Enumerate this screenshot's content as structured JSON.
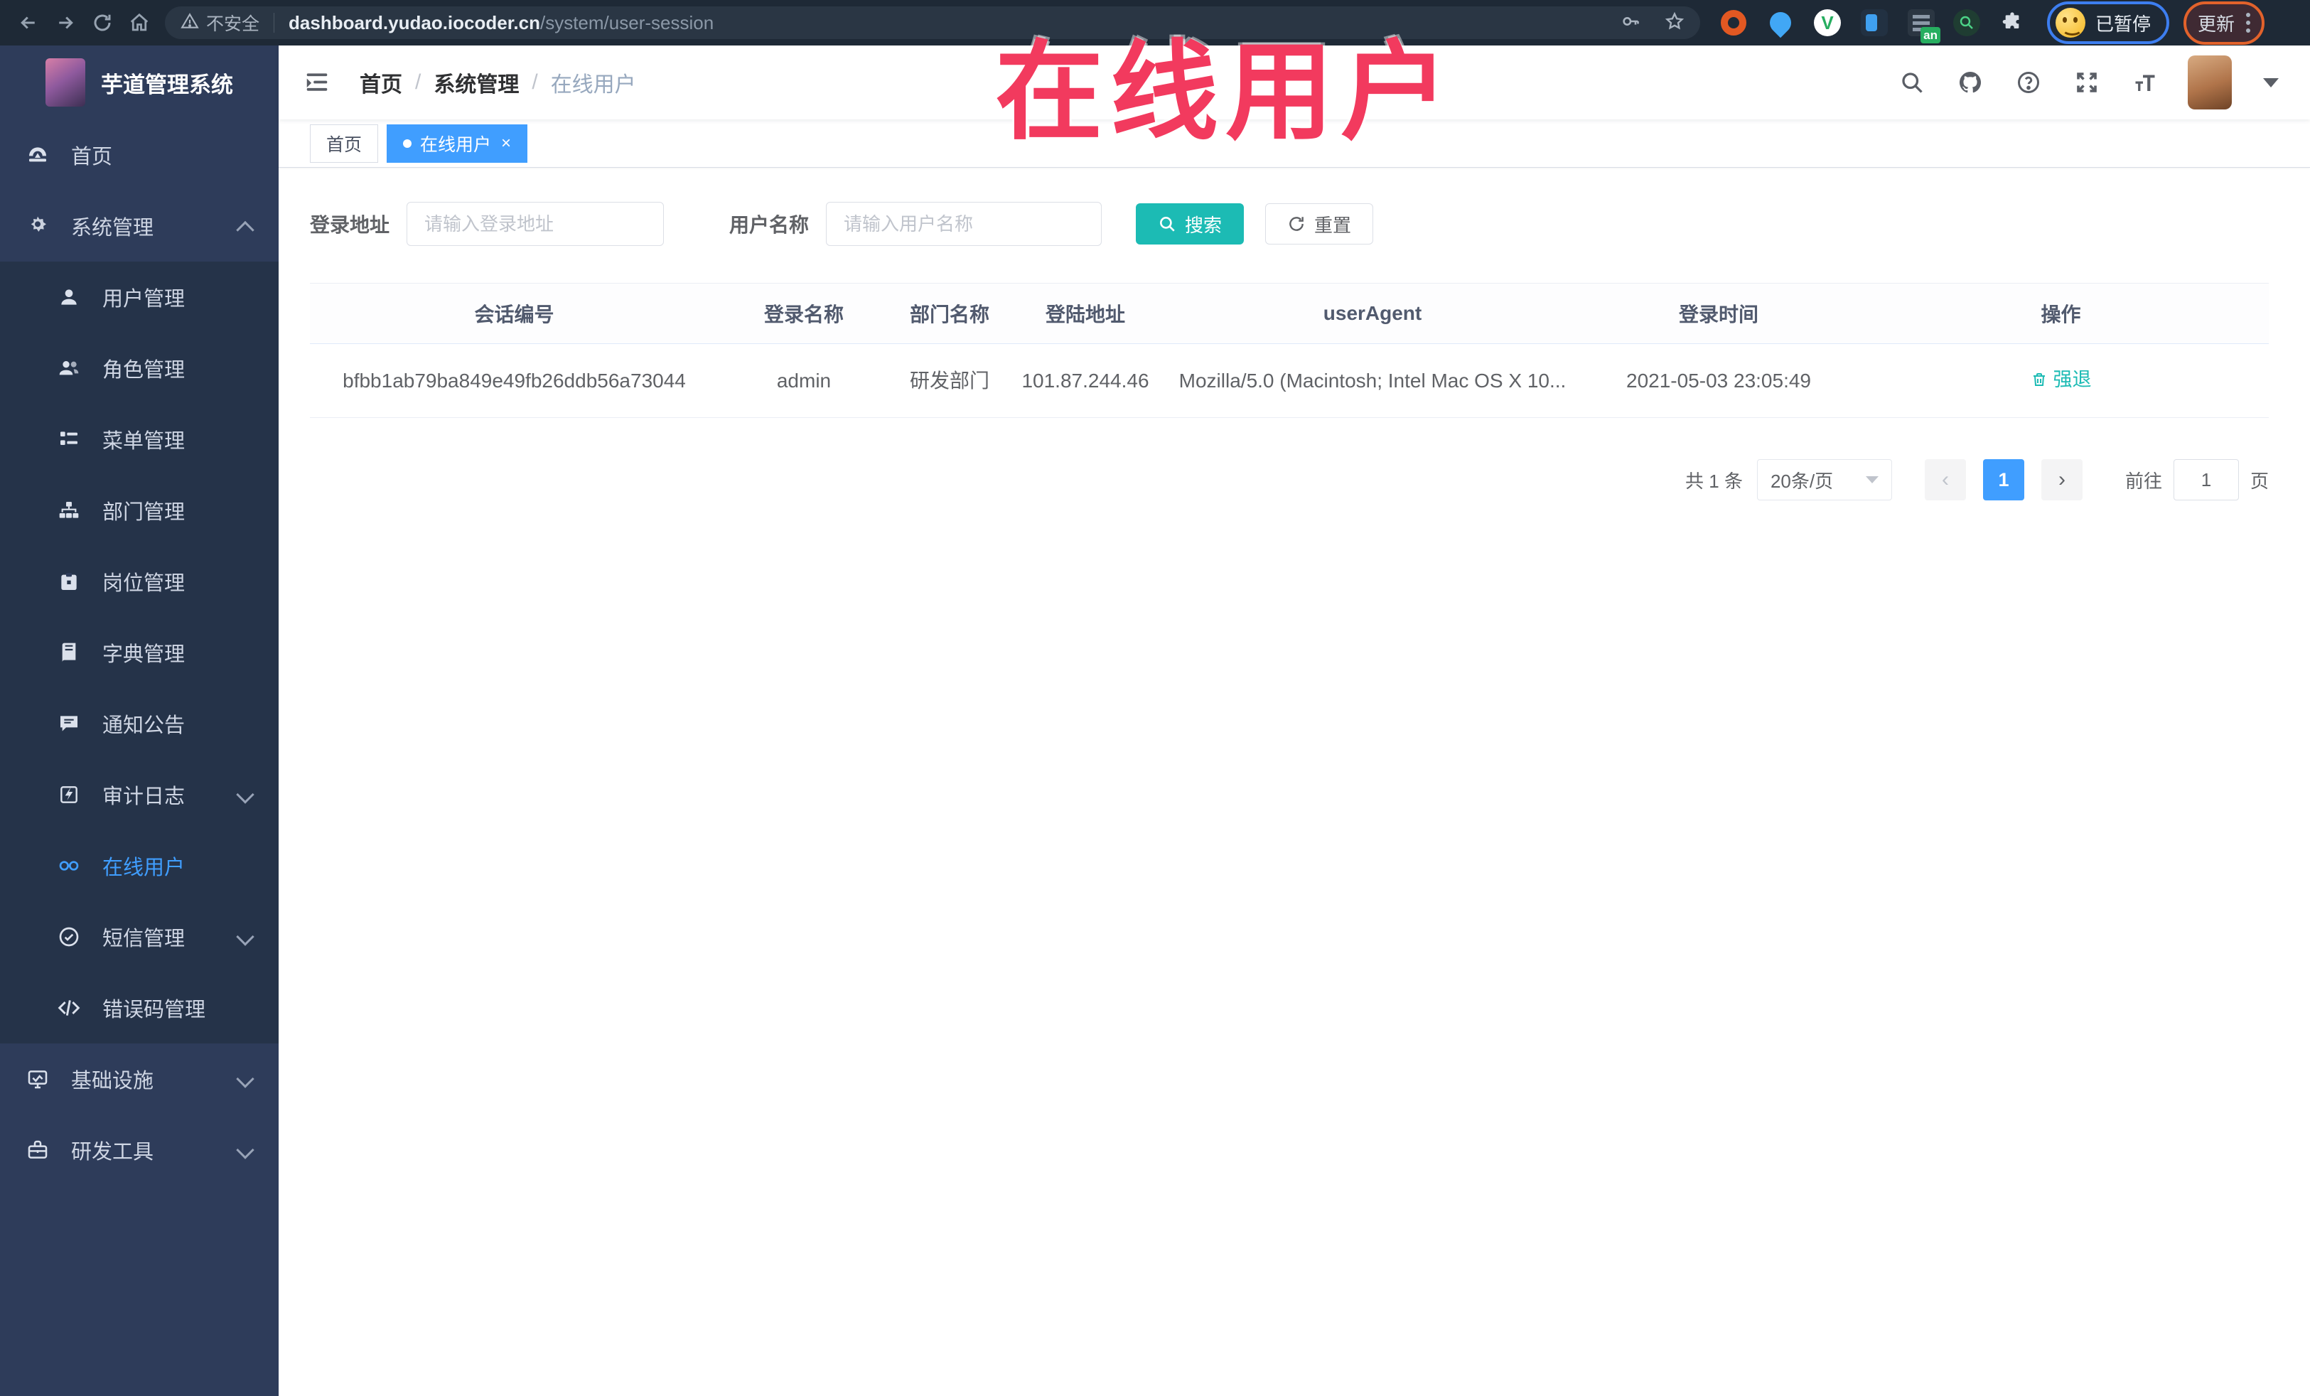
{
  "browser": {
    "security_label": "不安全",
    "url_domain": "dashboard.yudao.iocoder.cn",
    "url_path": "/system/user-session",
    "extension_badge": "an",
    "paused_label": "已暂停",
    "update_label": "更新"
  },
  "annotation": {
    "title_overlay": "在线用户"
  },
  "sidebar": {
    "logo_title": "芋道管理系统",
    "items": [
      {
        "label": "首页"
      },
      {
        "label": "系统管理",
        "expanded": true
      },
      {
        "label": "用户管理"
      },
      {
        "label": "角色管理"
      },
      {
        "label": "菜单管理"
      },
      {
        "label": "部门管理"
      },
      {
        "label": "岗位管理"
      },
      {
        "label": "字典管理"
      },
      {
        "label": "通知公告"
      },
      {
        "label": "审计日志",
        "collapsed": true
      },
      {
        "label": "在线用户",
        "active": true
      },
      {
        "label": "短信管理",
        "collapsed": true
      },
      {
        "label": "错误码管理"
      },
      {
        "label": "基础设施",
        "collapsed": true
      },
      {
        "label": "研发工具",
        "collapsed": true
      }
    ]
  },
  "header": {
    "breadcrumb": {
      "home": "首页",
      "parent": "系统管理",
      "current": "在线用户"
    }
  },
  "tabs": {
    "home": "首页",
    "current": "在线用户"
  },
  "filters": {
    "address_label": "登录地址",
    "address_placeholder": "请输入登录地址",
    "username_label": "用户名称",
    "username_placeholder": "请输入用户名称",
    "search_label": "搜索",
    "reset_label": "重置"
  },
  "table": {
    "columns": [
      "会话编号",
      "登录名称",
      "部门名称",
      "登陆地址",
      "userAgent",
      "登录时间",
      "操作"
    ],
    "rows": [
      {
        "session_id": "bfbb1ab79ba849e49fb26ddb56a73044",
        "login_name": "admin",
        "dept_name": "研发部门",
        "login_ip": "101.87.244.46",
        "user_agent": "Mozilla/5.0 (Macintosh; Intel Mac OS X 10...",
        "login_time": "2021-05-03 23:05:49",
        "action_label": "强退"
      }
    ]
  },
  "pagination": {
    "total": "共 1 条",
    "page_size": "20条/页",
    "current_page": "1",
    "goto_label": "前往",
    "goto_value": "1",
    "page_label": "页"
  },
  "colors": {
    "accent_teal": "#1cbbb4",
    "accent_blue": "#409eff",
    "overlay_red": "#f23a5e",
    "sidebar_bg": "#2e3c5a",
    "submenu_bg": "#253349"
  }
}
